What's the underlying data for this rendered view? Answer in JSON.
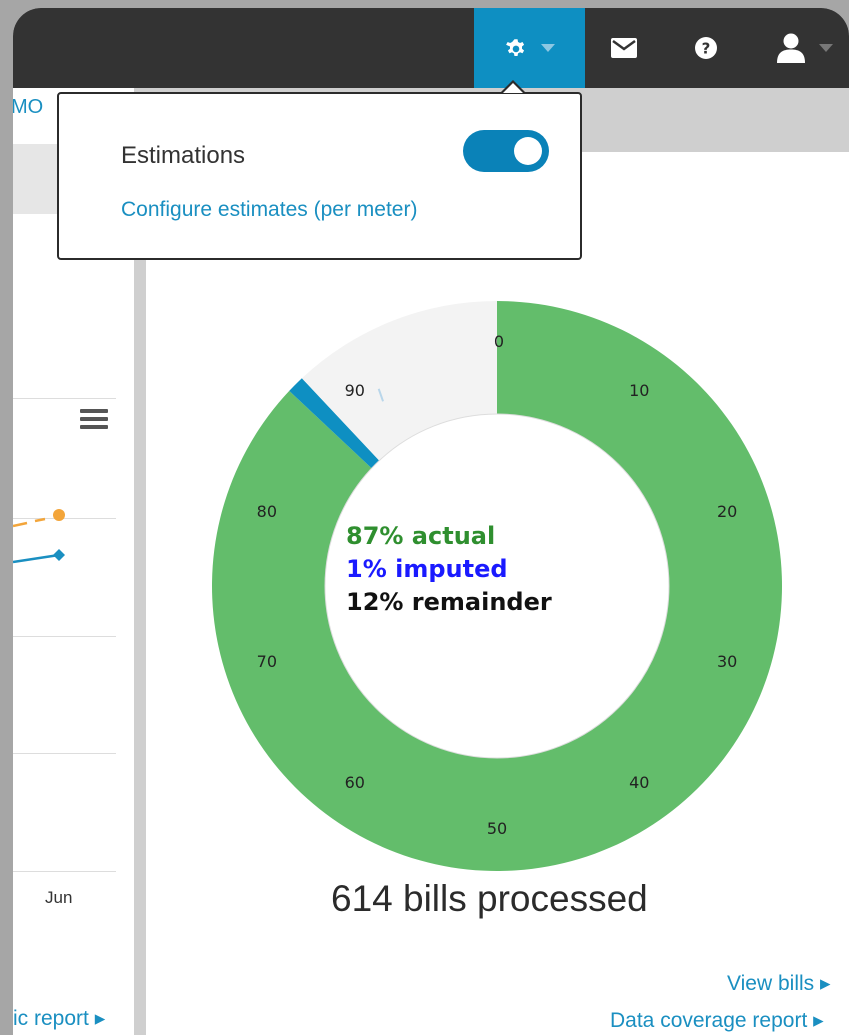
{
  "topbar": {
    "icons": [
      "gear-icon",
      "chevron-down-icon",
      "envelope-icon",
      "help-circle-icon",
      "user-icon"
    ],
    "settings_active_color": "#0e8fc2"
  },
  "left_panel": {
    "org_name": "MO",
    "x_label": "Jun",
    "report_link": "ic report ▸"
  },
  "settings_menu": {
    "estimations_label": "Estimations",
    "estimations_enabled": true,
    "configure_link": "Configure estimates (per meter)"
  },
  "main": {
    "bills_processed": "614 bills processed",
    "view_bills_link": "View bills ▸",
    "data_coverage_link": "Data coverage report ▸"
  },
  "chart_data": {
    "type": "pie",
    "variant": "donut",
    "categories": [
      "actual",
      "imputed",
      "remainder"
    ],
    "values": [
      87,
      1,
      12
    ],
    "colors": [
      "#63bd6b",
      "#0e8fc2",
      "#f3f3f3"
    ],
    "center_labels": [
      "87% actual",
      "1% imputed",
      "12% remainder"
    ],
    "scale_labels": [
      "0",
      "10",
      "20",
      "30",
      "40",
      "50",
      "60",
      "70",
      "80",
      "90"
    ]
  }
}
